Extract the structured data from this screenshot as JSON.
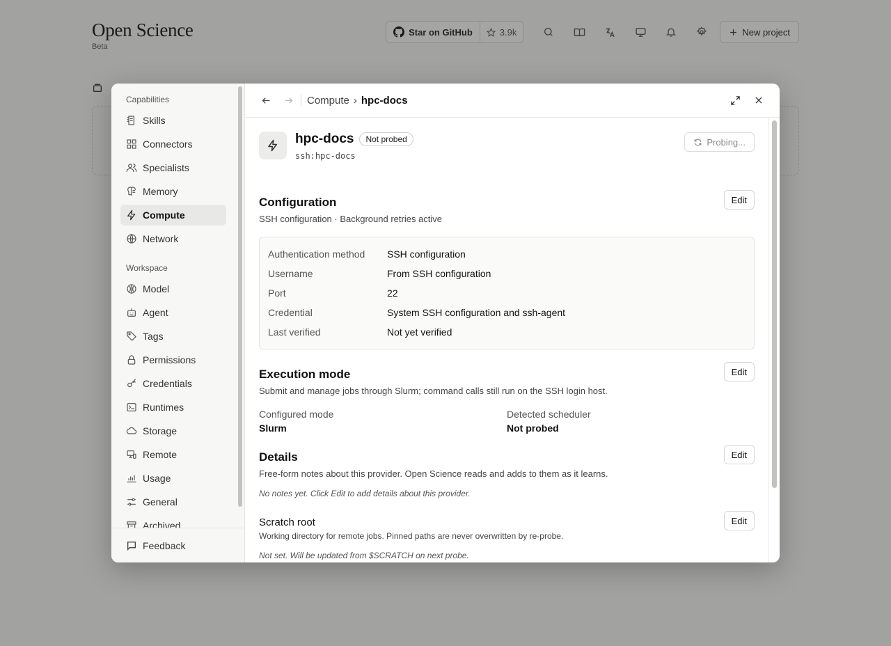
{
  "app": {
    "title": "Open Science",
    "subtitle": "Beta",
    "github_label": "Star on GitHub",
    "github_stars": "3.9k",
    "new_project_label": "New project"
  },
  "sidebar": {
    "group1": "Capabilities",
    "group2": "Workspace",
    "items1": [
      {
        "label": "Skills",
        "icon": "skills-icon"
      },
      {
        "label": "Connectors",
        "icon": "connectors-icon"
      },
      {
        "label": "Specialists",
        "icon": "specialists-icon"
      },
      {
        "label": "Memory",
        "icon": "memory-icon"
      },
      {
        "label": "Compute",
        "icon": "compute-icon",
        "active": true
      },
      {
        "label": "Network",
        "icon": "network-icon"
      }
    ],
    "items2": [
      {
        "label": "Model",
        "icon": "model-icon"
      },
      {
        "label": "Agent",
        "icon": "agent-icon"
      },
      {
        "label": "Tags",
        "icon": "tags-icon"
      },
      {
        "label": "Permissions",
        "icon": "lock-icon"
      },
      {
        "label": "Credentials",
        "icon": "key-icon"
      },
      {
        "label": "Runtimes",
        "icon": "terminal-icon"
      },
      {
        "label": "Storage",
        "icon": "cloud-icon"
      },
      {
        "label": "Remote",
        "icon": "remote-icon"
      },
      {
        "label": "Usage",
        "icon": "usage-icon"
      },
      {
        "label": "General",
        "icon": "sliders-icon"
      },
      {
        "label": "Archived",
        "icon": "archive-icon"
      }
    ],
    "feedback": "Feedback"
  },
  "header": {
    "crumb_parent": "Compute",
    "crumb_sep": "›",
    "crumb_current": "hpc-docs"
  },
  "provider": {
    "name": "hpc-docs",
    "badge": "Not probed",
    "id": "ssh:hpc-docs",
    "probe_label": "Probing..."
  },
  "configuration": {
    "title": "Configuration",
    "desc": "SSH configuration · Background retries active",
    "edit": "Edit",
    "rows": [
      {
        "key": "Authentication method",
        "value": "SSH configuration"
      },
      {
        "key": "Username",
        "value": "From SSH configuration"
      },
      {
        "key": "Port",
        "value": "22"
      },
      {
        "key": "Credential",
        "value": "System SSH configuration and ssh-agent"
      },
      {
        "key": "Last verified",
        "value": "Not yet verified"
      }
    ]
  },
  "execution": {
    "title": "Execution mode",
    "desc": "Submit and manage jobs through Slurm; command calls still run on the SSH login host.",
    "edit": "Edit",
    "configured_label": "Configured mode",
    "configured_value": "Slurm",
    "detected_label": "Detected scheduler",
    "detected_value": "Not probed"
  },
  "details": {
    "title": "Details",
    "desc": "Free-form notes about this provider. Open Science reads and adds to them as it learns.",
    "edit": "Edit",
    "note": "No notes yet. Click Edit to add details about this provider."
  },
  "scratch": {
    "title": "Scratch root",
    "desc": "Working directory for remote jobs. Pinned paths are never overwritten by re-probe.",
    "edit": "Edit",
    "note": "Not set. Will be updated from $SCRATCH on next probe."
  }
}
